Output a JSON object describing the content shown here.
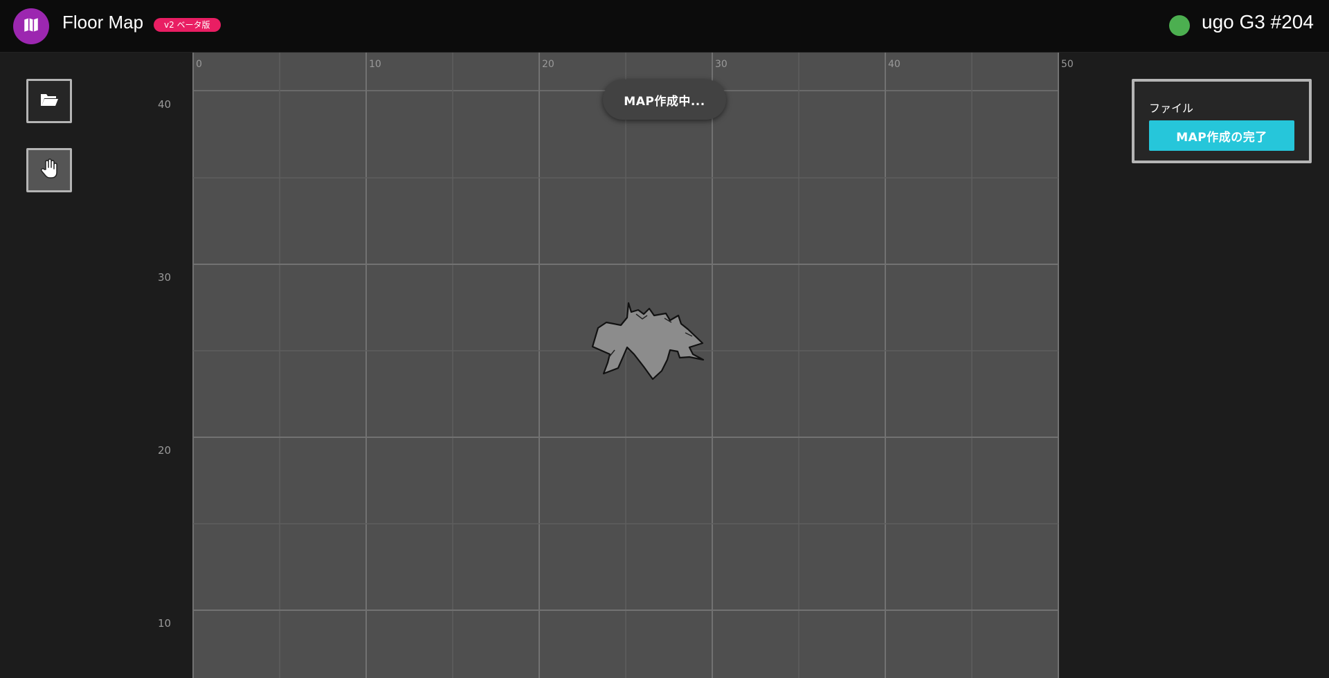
{
  "header": {
    "app_title": "Floor Map",
    "beta_badge": "v2 ベータ版",
    "robot_name": "ugo G3 #204",
    "status_color": "#4caf50",
    "logo_icon": "map-icon",
    "logo_color": "#9c27b0"
  },
  "toolbar": {
    "items": [
      {
        "name": "open-folder",
        "icon": "folder-open-icon"
      },
      {
        "name": "pan",
        "icon": "hand-icon"
      }
    ]
  },
  "map": {
    "status_text": "MAP作成中...",
    "x_ticks": [
      "0",
      "10",
      "20",
      "30",
      "40",
      "50"
    ],
    "y_ticks": [
      "40",
      "30",
      "20",
      "10"
    ]
  },
  "file_panel": {
    "label": "ファイル",
    "complete_button": "MAP作成の完了",
    "accent_color": "#26c6da"
  }
}
